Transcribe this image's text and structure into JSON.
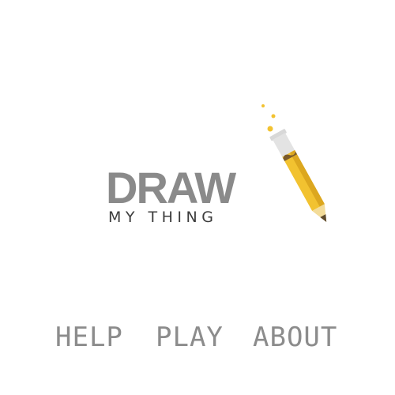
{
  "logo": {
    "title_main": "DRAW",
    "title_sub": "MY THING",
    "icon": "pencil-icon",
    "colors": {
      "title_main": "#8a8a8a",
      "title_sub": "#3c3c3c",
      "pencil_body": "#f2c230",
      "pencil_shade": "#d9a51e",
      "pencil_cap": "#d2d2d2",
      "sparkles": "#f2c230"
    }
  },
  "menu": {
    "help_label": "HELP",
    "play_label": "PLAY",
    "about_label": "ABOUT",
    "color": "#8c8c8c"
  }
}
